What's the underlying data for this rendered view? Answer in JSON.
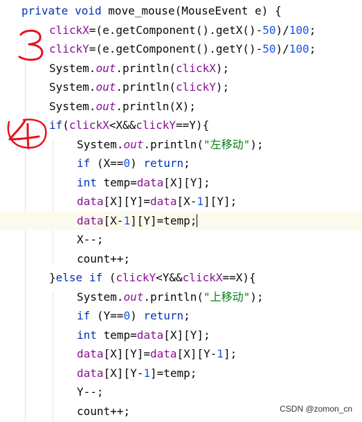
{
  "editor": {
    "lines": [
      {
        "indent": 0,
        "text": "private void move_mouse(MouseEvent e) {"
      },
      {
        "indent": 1,
        "text": "clickX=(e.getComponent().getX()-50)/100;"
      },
      {
        "indent": 1,
        "text": "clickY=(e.getComponent().getY()-50)/100;"
      },
      {
        "indent": 1,
        "text": "System.out.println(clickX);"
      },
      {
        "indent": 1,
        "text": "System.out.println(clickY);"
      },
      {
        "indent": 1,
        "text": "System.out.println(X);"
      },
      {
        "indent": 1,
        "text": "if(clickX<X&&clickY==Y){"
      },
      {
        "indent": 2,
        "text": "System.out.println(\"左移动\");"
      },
      {
        "indent": 2,
        "text": "if (X==0) return;"
      },
      {
        "indent": 2,
        "text": "int temp=data[X][Y];"
      },
      {
        "indent": 2,
        "text": "data[X][Y]=data[X-1][Y];"
      },
      {
        "indent": 2,
        "text": "data[X-1][Y]=temp;"
      },
      {
        "indent": 2,
        "text": "X--;"
      },
      {
        "indent": 2,
        "text": "count++;"
      },
      {
        "indent": 1,
        "text": "}else if (clickY<Y&&clickX==X){"
      },
      {
        "indent": 2,
        "text": "System.out.println(\"上移动\");"
      },
      {
        "indent": 2,
        "text": "if (Y==0) return;"
      },
      {
        "indent": 2,
        "text": "int temp=data[X][Y];"
      },
      {
        "indent": 2,
        "text": "data[X][Y]=data[X][Y-1];"
      },
      {
        "indent": 2,
        "text": "data[X][Y-1]=temp;"
      },
      {
        "indent": 2,
        "text": "Y--;"
      },
      {
        "indent": 2,
        "text": "count++;"
      }
    ],
    "current_line": 11
  },
  "annotations": [
    "3",
    "4"
  ],
  "watermark": "CSDN @zomon_cn",
  "colors": {
    "keyword": "#0033b3",
    "field": "#871094",
    "number": "#1750eb",
    "string": "#067d17",
    "annotation": "#e8101e"
  }
}
